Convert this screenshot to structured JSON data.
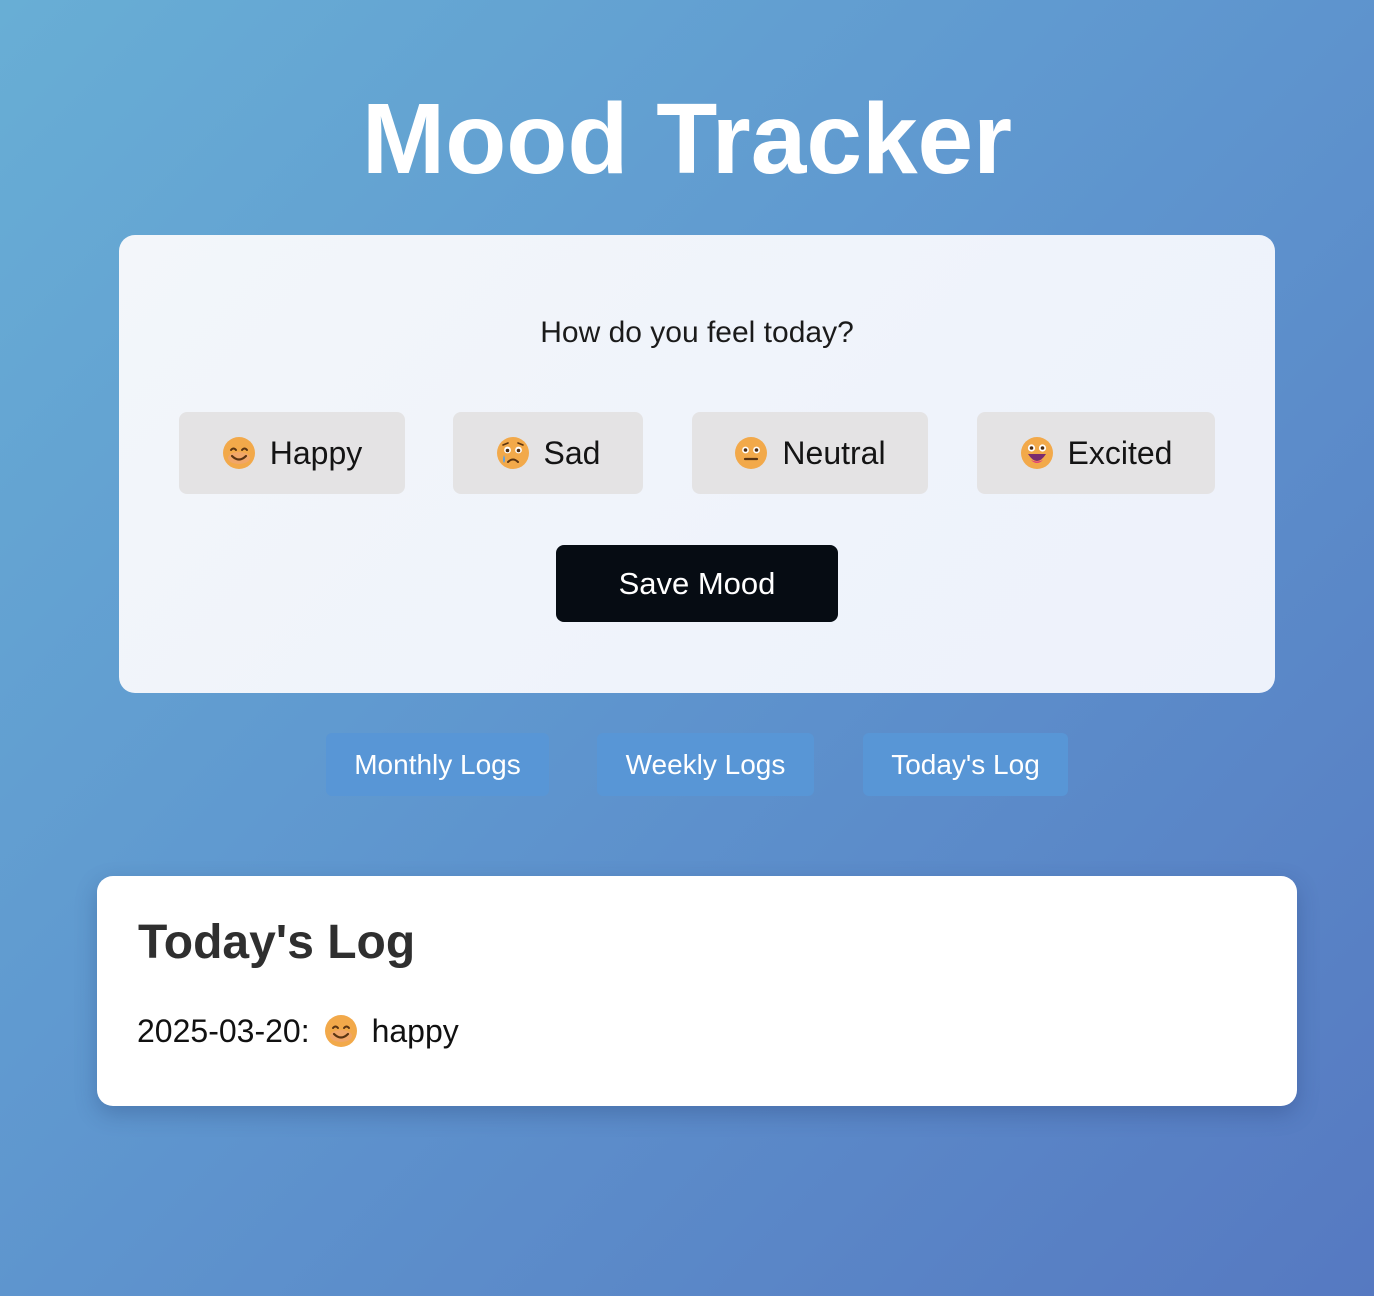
{
  "title": "Mood Tracker",
  "prompt": "How do you feel today?",
  "moods": [
    {
      "label": "Happy",
      "icon": "smiling-face-icon"
    },
    {
      "label": "Sad",
      "icon": "crying-face-icon"
    },
    {
      "label": "Neutral",
      "icon": "neutral-face-icon"
    },
    {
      "label": "Excited",
      "icon": "excited-face-icon"
    }
  ],
  "save_label": "Save Mood",
  "nav": {
    "monthly": "Monthly Logs",
    "weekly": "Weekly Logs",
    "today": "Today's Log"
  },
  "log": {
    "heading": "Today's Log",
    "entries": [
      {
        "date": "2025-03-20:",
        "mood": "happy",
        "icon": "smiling-face-icon"
      }
    ]
  },
  "colors": {
    "background_start": "#68aed5",
    "background_end": "#5679c1",
    "mood_button": "#e4e3e4",
    "save_button": "#060c13",
    "nav_button": "#5896d6",
    "emoji_face": "#f2a94a"
  }
}
